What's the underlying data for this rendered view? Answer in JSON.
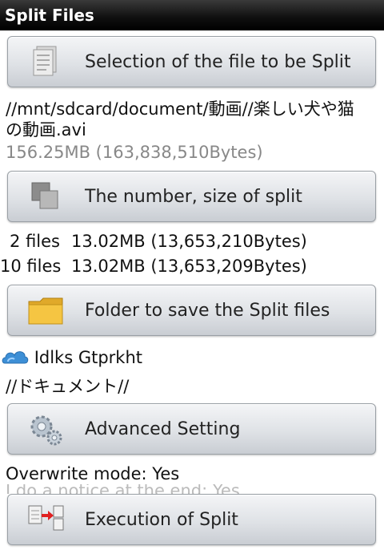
{
  "title_bar": {
    "title": "Split Files"
  },
  "buttons": {
    "select_file": "Selection of the file to be Split",
    "split_count": "The number, size of split",
    "save_folder": "Folder to save the Split files",
    "advanced": "Advanced Setting",
    "execute": "Execution of Split"
  },
  "file": {
    "path": "//mnt/sdcard/document/動画//楽しい犬や猫",
    "path_cont": "の動画.avi",
    "size": "156.25MB (163,838,510Bytes)"
  },
  "split_info": [
    {
      "count": "2 files",
      "size": "13.02MB (13,653,210Bytes)"
    },
    {
      "count": "10 files",
      "size": "13.02MB (13,653,209Bytes)"
    }
  ],
  "destination": {
    "account": "Idlks Gtprkht",
    "folder": "//ドキュメント//",
    "icon": "cloud-drive-icon"
  },
  "settings": {
    "overwrite": "Overwrite mode: Yes",
    "notice": "I do a notice at the end: Yes"
  },
  "icons": {
    "select_file": "document-icon",
    "split_count": "stacked-squares-icon",
    "save_folder": "folder-icon",
    "advanced": "gears-icon",
    "execute": "split-arrow-icon"
  }
}
